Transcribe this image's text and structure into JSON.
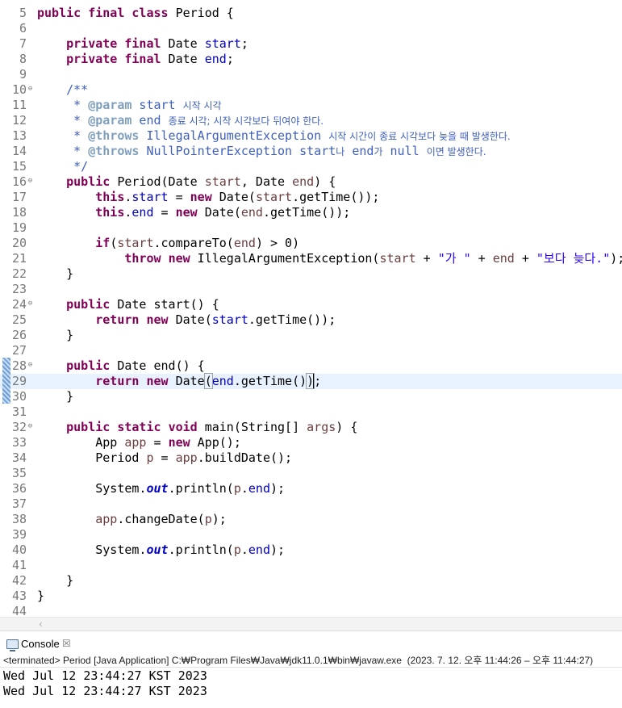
{
  "editor": {
    "lines": [
      {
        "n": "5",
        "fold": false,
        "tokens": [
          [
            "kw",
            "public"
          ],
          [
            "",
            " "
          ],
          [
            "kw",
            "final"
          ],
          [
            "",
            " "
          ],
          [
            "kw",
            "class"
          ],
          [
            "",
            " Period {"
          ]
        ]
      },
      {
        "n": "6",
        "fold": false,
        "tokens": []
      },
      {
        "n": "7",
        "fold": false,
        "tokens": [
          [
            "",
            "    "
          ],
          [
            "kw",
            "private"
          ],
          [
            "",
            " "
          ],
          [
            "kw",
            "final"
          ],
          [
            "",
            " Date "
          ],
          [
            "fd",
            "start"
          ],
          [
            "",
            ";"
          ]
        ]
      },
      {
        "n": "8",
        "fold": false,
        "tokens": [
          [
            "",
            "    "
          ],
          [
            "kw",
            "private"
          ],
          [
            "",
            " "
          ],
          [
            "kw",
            "final"
          ],
          [
            "",
            " Date "
          ],
          [
            "fd",
            "end"
          ],
          [
            "",
            ";"
          ]
        ]
      },
      {
        "n": "9",
        "fold": false,
        "tokens": []
      },
      {
        "n": "10",
        "fold": true,
        "tokens": [
          [
            "jd",
            "    /**"
          ]
        ]
      },
      {
        "n": "11",
        "fold": false,
        "tokens": [
          [
            "jd",
            "     * "
          ],
          [
            "jt",
            "@param"
          ],
          [
            "jd",
            " start "
          ],
          [
            "jd ko",
            "시작 시각"
          ]
        ]
      },
      {
        "n": "12",
        "fold": false,
        "tokens": [
          [
            "jd",
            "     * "
          ],
          [
            "jt",
            "@param"
          ],
          [
            "jd",
            " end "
          ],
          [
            "jd ko",
            "종료 시각; 시작 시각보다 뒤여야 한다."
          ]
        ]
      },
      {
        "n": "13",
        "fold": false,
        "tokens": [
          [
            "jd",
            "     * "
          ],
          [
            "jt",
            "@throws"
          ],
          [
            "jd",
            " IllegalArgumentException "
          ],
          [
            "jd ko",
            "시작 시간이 종료 시각보다 늦을 때 발생한다."
          ]
        ]
      },
      {
        "n": "14",
        "fold": false,
        "tokens": [
          [
            "jd",
            "     * "
          ],
          [
            "jt",
            "@throws"
          ],
          [
            "jd",
            " NullPointerException start"
          ],
          [
            "jd ko",
            "나"
          ],
          [
            "jd",
            " end"
          ],
          [
            "jd ko",
            "가"
          ],
          [
            "jd",
            " null "
          ],
          [
            "jd ko",
            "이면 발생한다."
          ]
        ]
      },
      {
        "n": "15",
        "fold": false,
        "tokens": [
          [
            "jd",
            "     */"
          ]
        ]
      },
      {
        "n": "16",
        "fold": true,
        "tokens": [
          [
            "",
            "    "
          ],
          [
            "kw",
            "public"
          ],
          [
            "",
            " Period(Date "
          ],
          [
            "lv",
            "start"
          ],
          [
            "",
            ", Date "
          ],
          [
            "lv",
            "end"
          ],
          [
            "",
            ") {"
          ]
        ]
      },
      {
        "n": "17",
        "fold": false,
        "tokens": [
          [
            "",
            "        "
          ],
          [
            "kw",
            "this"
          ],
          [
            "",
            "."
          ],
          [
            "fd",
            "start"
          ],
          [
            "",
            " = "
          ],
          [
            "kw",
            "new"
          ],
          [
            "",
            " Date("
          ],
          [
            "lv",
            "start"
          ],
          [
            "",
            ".getTime());"
          ]
        ]
      },
      {
        "n": "18",
        "fold": false,
        "tokens": [
          [
            "",
            "        "
          ],
          [
            "kw",
            "this"
          ],
          [
            "",
            "."
          ],
          [
            "fd",
            "end"
          ],
          [
            "",
            " = "
          ],
          [
            "kw",
            "new"
          ],
          [
            "",
            " Date("
          ],
          [
            "lv",
            "end"
          ],
          [
            "",
            ".getTime());"
          ]
        ]
      },
      {
        "n": "19",
        "fold": false,
        "tokens": []
      },
      {
        "n": "20",
        "fold": false,
        "tokens": [
          [
            "",
            "        "
          ],
          [
            "kw",
            "if"
          ],
          [
            "",
            "("
          ],
          [
            "lv",
            "start"
          ],
          [
            "",
            ".compareTo("
          ],
          [
            "lv",
            "end"
          ],
          [
            "",
            ") > 0)"
          ]
        ]
      },
      {
        "n": "21",
        "fold": false,
        "tokens": [
          [
            "",
            "            "
          ],
          [
            "kw",
            "throw"
          ],
          [
            "",
            " "
          ],
          [
            "kw",
            "new"
          ],
          [
            "",
            " IllegalArgumentException("
          ],
          [
            "lv",
            "start"
          ],
          [
            "",
            " + "
          ],
          [
            "st",
            "\"가 \""
          ],
          [
            "",
            " + "
          ],
          [
            "lv",
            "end"
          ],
          [
            "",
            " + "
          ],
          [
            "st",
            "\"보다 늦다.\""
          ],
          [
            "",
            ");"
          ]
        ]
      },
      {
        "n": "22",
        "fold": false,
        "tokens": [
          [
            "",
            "    }"
          ]
        ]
      },
      {
        "n": "23",
        "fold": false,
        "tokens": []
      },
      {
        "n": "24",
        "fold": true,
        "tokens": [
          [
            "",
            "    "
          ],
          [
            "kw",
            "public"
          ],
          [
            "",
            " Date start() {"
          ]
        ]
      },
      {
        "n": "25",
        "fold": false,
        "tokens": [
          [
            "",
            "        "
          ],
          [
            "kw",
            "return"
          ],
          [
            "",
            " "
          ],
          [
            "kw",
            "new"
          ],
          [
            "",
            " Date("
          ],
          [
            "fd",
            "start"
          ],
          [
            "",
            ".getTime());"
          ]
        ]
      },
      {
        "n": "26",
        "fold": false,
        "tokens": [
          [
            "",
            "    }"
          ]
        ]
      },
      {
        "n": "27",
        "fold": false,
        "tokens": []
      },
      {
        "n": "28",
        "fold": true,
        "tokens": [
          [
            "",
            "    "
          ],
          [
            "kw",
            "public"
          ],
          [
            "",
            " Date end() {"
          ]
        ]
      },
      {
        "n": "29",
        "fold": false,
        "current": true,
        "tokens": [
          [
            "",
            "        "
          ],
          [
            "kw",
            "return"
          ],
          [
            "",
            " "
          ],
          [
            "kw",
            "new"
          ],
          [
            "",
            " Date"
          ],
          [
            "bm",
            "("
          ],
          [
            "fd",
            "end"
          ],
          [
            "",
            ".getTime()"
          ],
          [
            "bm",
            ")"
          ],
          [
            "caret",
            ""
          ],
          [
            "",
            ";"
          ]
        ]
      },
      {
        "n": "30",
        "fold": false,
        "tokens": [
          [
            "",
            "    }"
          ]
        ]
      },
      {
        "n": "31",
        "fold": false,
        "tokens": []
      },
      {
        "n": "32",
        "fold": true,
        "tokens": [
          [
            "",
            "    "
          ],
          [
            "kw",
            "public"
          ],
          [
            "",
            " "
          ],
          [
            "kw",
            "static"
          ],
          [
            "",
            " "
          ],
          [
            "kw",
            "void"
          ],
          [
            "",
            " main(String[] "
          ],
          [
            "lv",
            "args"
          ],
          [
            "",
            ") {"
          ]
        ]
      },
      {
        "n": "33",
        "fold": false,
        "tokens": [
          [
            "",
            "        App "
          ],
          [
            "lv",
            "app"
          ],
          [
            "",
            " = "
          ],
          [
            "kw",
            "new"
          ],
          [
            "",
            " App();"
          ]
        ]
      },
      {
        "n": "34",
        "fold": false,
        "tokens": [
          [
            "",
            "        Period "
          ],
          [
            "lv",
            "p"
          ],
          [
            "",
            " = "
          ],
          [
            "lv",
            "app"
          ],
          [
            "",
            ".buildDate();"
          ]
        ]
      },
      {
        "n": "35",
        "fold": false,
        "tokens": []
      },
      {
        "n": "36",
        "fold": false,
        "tokens": [
          [
            "",
            "        System."
          ],
          [
            "sf",
            "out"
          ],
          [
            "",
            ".println("
          ],
          [
            "lv",
            "p"
          ],
          [
            "",
            "."
          ],
          [
            "fd",
            "end"
          ],
          [
            "",
            ");"
          ]
        ]
      },
      {
        "n": "37",
        "fold": false,
        "tokens": []
      },
      {
        "n": "38",
        "fold": false,
        "tokens": [
          [
            "",
            "        "
          ],
          [
            "lv",
            "app"
          ],
          [
            "",
            ".changeDate("
          ],
          [
            "lv",
            "p"
          ],
          [
            "",
            ");"
          ]
        ]
      },
      {
        "n": "39",
        "fold": false,
        "tokens": []
      },
      {
        "n": "40",
        "fold": false,
        "tokens": [
          [
            "",
            "        System."
          ],
          [
            "sf",
            "out"
          ],
          [
            "",
            ".println("
          ],
          [
            "lv",
            "p"
          ],
          [
            "",
            "."
          ],
          [
            "fd",
            "end"
          ],
          [
            "",
            ");"
          ]
        ]
      },
      {
        "n": "41",
        "fold": false,
        "tokens": []
      },
      {
        "n": "42",
        "fold": false,
        "tokens": [
          [
            "",
            "    }"
          ]
        ]
      },
      {
        "n": "43",
        "fold": false,
        "tokens": [
          [
            "",
            "}"
          ]
        ]
      },
      {
        "n": "44",
        "fold": false,
        "tokens": []
      }
    ]
  },
  "console": {
    "tab_label": "Console",
    "close_glyph": "☒",
    "status": "<terminated> Period [Java Application] C:₩Program Files₩Java₩jdk11.0.1₩bin₩javaw.exe  (2023. 7. 12. 오후 11:44:26 – 오후 11:44:27)",
    "output": [
      "Wed Jul 12 23:44:27 KST 2023",
      "Wed Jul 12 23:44:27 KST 2023"
    ]
  },
  "scrollbar": {
    "left_arrow": "‹"
  },
  "fold_glyph": "⊖"
}
